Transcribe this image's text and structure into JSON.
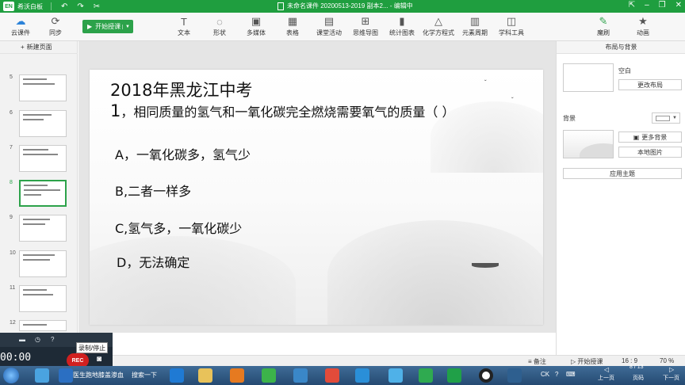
{
  "titlebar": {
    "app_name": "希沃白板",
    "doc_title": "未命名课件 20200513-2019 副本2... - 编辑中",
    "min": "–",
    "restore": "❐",
    "close": "✕"
  },
  "toolbar": {
    "cloud_label": "云课件",
    "sync_label": "同步",
    "start_label": "开始授课",
    "tools": [
      {
        "label": "文本",
        "icon": "T"
      },
      {
        "label": "形状",
        "icon": "◌"
      },
      {
        "label": "多媒体",
        "icon": "▣"
      },
      {
        "label": "表格",
        "icon": "▦"
      },
      {
        "label": "课堂活动",
        "icon": "▤"
      },
      {
        "label": "思维导图",
        "icon": "⊞"
      },
      {
        "label": "统计图表",
        "icon": "▮"
      },
      {
        "label": "化学方程式",
        "icon": "△"
      },
      {
        "label": "元素周期",
        "icon": "▥"
      },
      {
        "label": "学科工具",
        "icon": "◫"
      }
    ],
    "brush_label": "魔刷",
    "anim_label": "动画"
  },
  "left": {
    "new_page": "新建页面",
    "thumbs": [
      "5",
      "6",
      "7",
      "8",
      "9",
      "10",
      "11",
      "12"
    ],
    "active": "8"
  },
  "slide": {
    "title": "2018年黑龙江中考",
    "qnum": "1",
    "question": "，相同质量的氢气和一氧化碳完全燃烧需要氧气的质量（    ）",
    "options": [
      "A，一氧化碳多，氢气少",
      "B,二者一样多",
      "C,氢气多，一氧化碳少",
      "D，无法确定"
    ]
  },
  "right": {
    "panel_title": "布局与背景",
    "layout_name": "空白",
    "change_layout": "更改布局",
    "bg_label": "背景",
    "more_bg": "更多背景",
    "local_img": "本地图片",
    "apply_theme": "应用主题"
  },
  "status": {
    "notes": "备注",
    "start": "开始授课",
    "ratio": "16 : 9",
    "zoom": "70 %",
    "prev": "上一页",
    "page": "8 / 13",
    "page_label": "页码",
    "next": "下一页"
  },
  "recorder": {
    "time": "00:00",
    "rec": "REC",
    "tooltip": "录制/停止"
  },
  "taskbar": {
    "item_text": "医生跑地膝盖渗血",
    "search_text": "搜索一下",
    "ime": "CK"
  }
}
